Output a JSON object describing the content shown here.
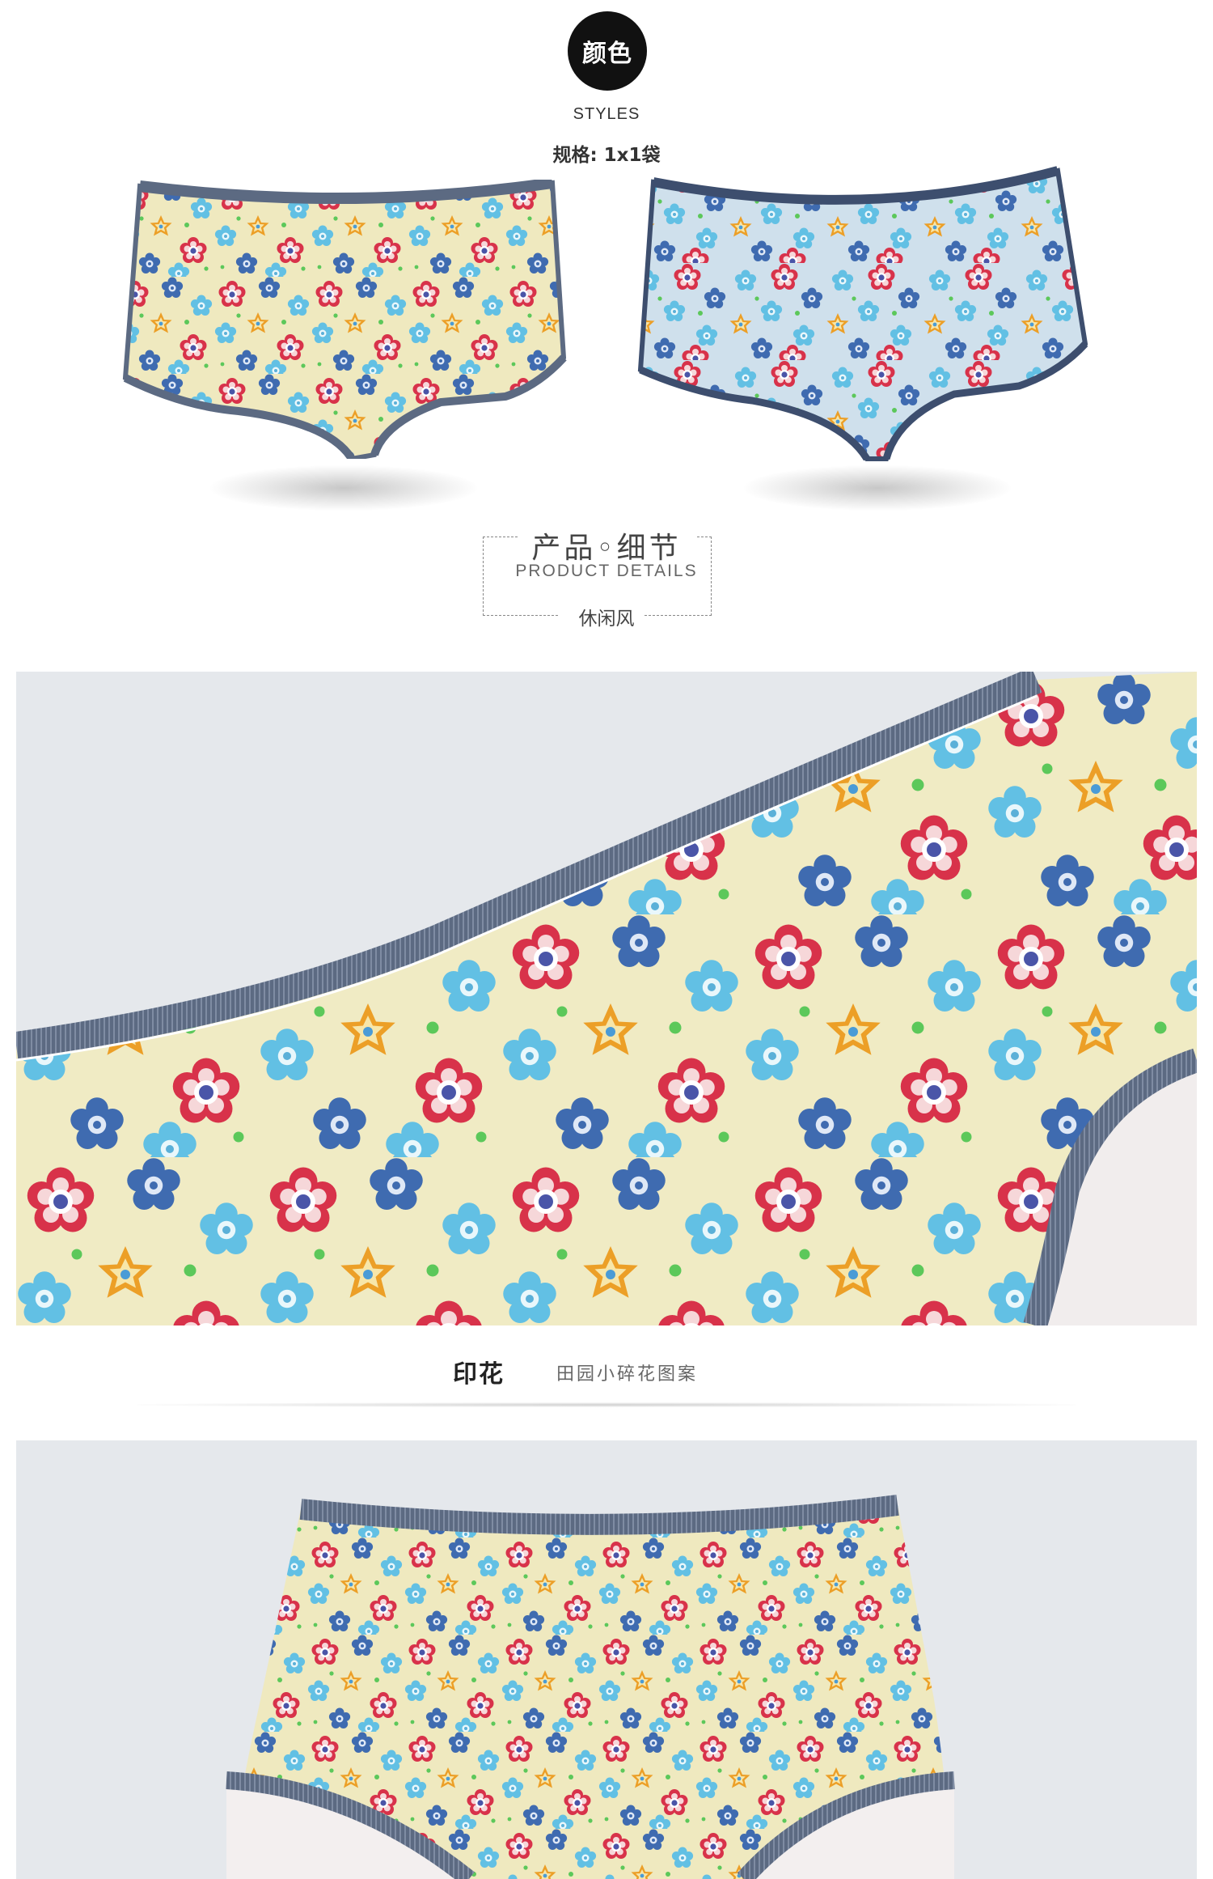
{
  "header": {
    "badge_label": "颜色",
    "styles_label": "STYLES",
    "spec_label": "规格: 1x1袋"
  },
  "products": [
    {
      "name": "yellow-floral-briefs"
    },
    {
      "name": "blue-floral-briefs"
    }
  ],
  "details": {
    "title": "产品◦细节",
    "subtitle": "PRODUCT DETAILS",
    "style": "休闲风"
  },
  "caption": {
    "main": "印花",
    "sub": "田园小碎花图案"
  },
  "colors": {
    "fabric_yellow": "#efe9bf",
    "fabric_blue": "#cfe0ec",
    "trim": "#5c6a82",
    "flower_red": "#c8283a",
    "flower_blue": "#3f6bb0",
    "flower_cyan": "#5ab8dc",
    "flower_orange": "#e8a02a",
    "dot_green": "#5cc85a",
    "panel_bg": "#e5e8ec"
  }
}
